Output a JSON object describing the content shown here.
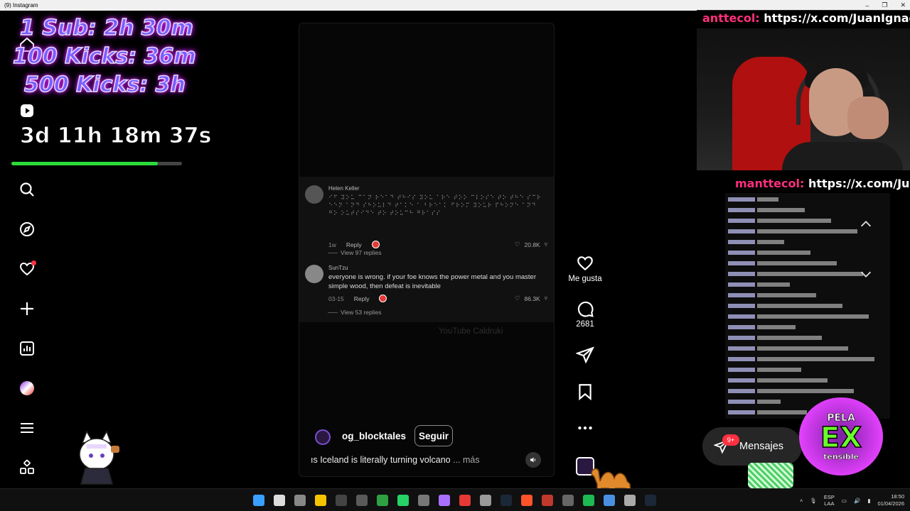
{
  "window": {
    "title": "(9) Instagram",
    "controls": [
      "–",
      "❐",
      "✕"
    ]
  },
  "stream_overlay": {
    "goals": [
      "1 Sub: 2h 30m",
      "100 Kicks: 36m",
      "500 Kicks: 3h"
    ],
    "timer": "3d 11h 18m 37s",
    "progress_percent": 86,
    "top_chat": {
      "user": "anttecol:",
      "text": "https://x.com/JuanIgnacio"
    },
    "lower_chat": {
      "user": "manttecol:",
      "text": "https://x.com/Ju"
    }
  },
  "sidebar": {
    "icons": [
      "home-icon",
      "reels-icon",
      "search-icon",
      "explore-icon",
      "notifications-icon",
      "create-icon",
      "dashboard-icon",
      "profile-avatar",
      "menu-icon",
      "apps-icon"
    ]
  },
  "reel": {
    "comments": [
      {
        "user": "Helen Keller",
        "text": "⠊⠋ ⠽⠕⠥ ⠉⠁⠝ ⠗⠑⠁⠙ ⠞⠓⠊⠎ ⠽⠕⠥ ⠁⠗⠑ ⠞⠕⠕ ⠉⠇⠕⠎⠑ ⠞⠕ ⠞⠓⠑ ⠎⠉⠗⠑⠑⠝ ⠁⠝⠙ ⠎⠓⠕⠥⠇⠙ ⠞⠁⠅⠑ ⠁ ⠃⠗⠑⠁⠅ ⠋⠗⠕⠍ ⠽⠕⠥⠗ ⠏⠓⠕⠝⠑ ⠁⠝⠙ ⠛⠕ ⠕⠥⠞⠎⠊⠙⠑ ⠞⠕ ⠞⠕⠥⠉⠓ ⠛⠗⠁⠎⠎",
        "time": "1w",
        "reply": "Reply",
        "likes": "20.8K",
        "view_replies": "View 97 replies"
      },
      {
        "user": "SunTzu",
        "text": "everyone is wrong. if your foe knows the power metal and you master simple wood, then defeat is inevitable",
        "time": "03-15",
        "reply": "Reply",
        "likes": "86.3K",
        "view_replies": "View 53 replies"
      }
    ],
    "watermark": "YouTube Caldruki",
    "author": "og_blocktales",
    "follow_label": "Seguir",
    "caption": "ıs Iceland is literally turning volcano",
    "more_label": "... más"
  },
  "actions": {
    "like_label": "Me gusta",
    "comment_count": "2681"
  },
  "messages": {
    "label": "Mensajes",
    "badge": "9+"
  },
  "logo": {
    "line1": "PELA",
    "line2": "EX",
    "line3": "tensible"
  },
  "taskbar": {
    "lang_top": "ESP",
    "lang_bottom": "LAA",
    "time": "18:50",
    "date": "01/04/2026"
  },
  "colors": {
    "accent_red": "#ff3040",
    "progress_green": "#2bdc3a",
    "overlay_purple": "#7a5cff"
  }
}
